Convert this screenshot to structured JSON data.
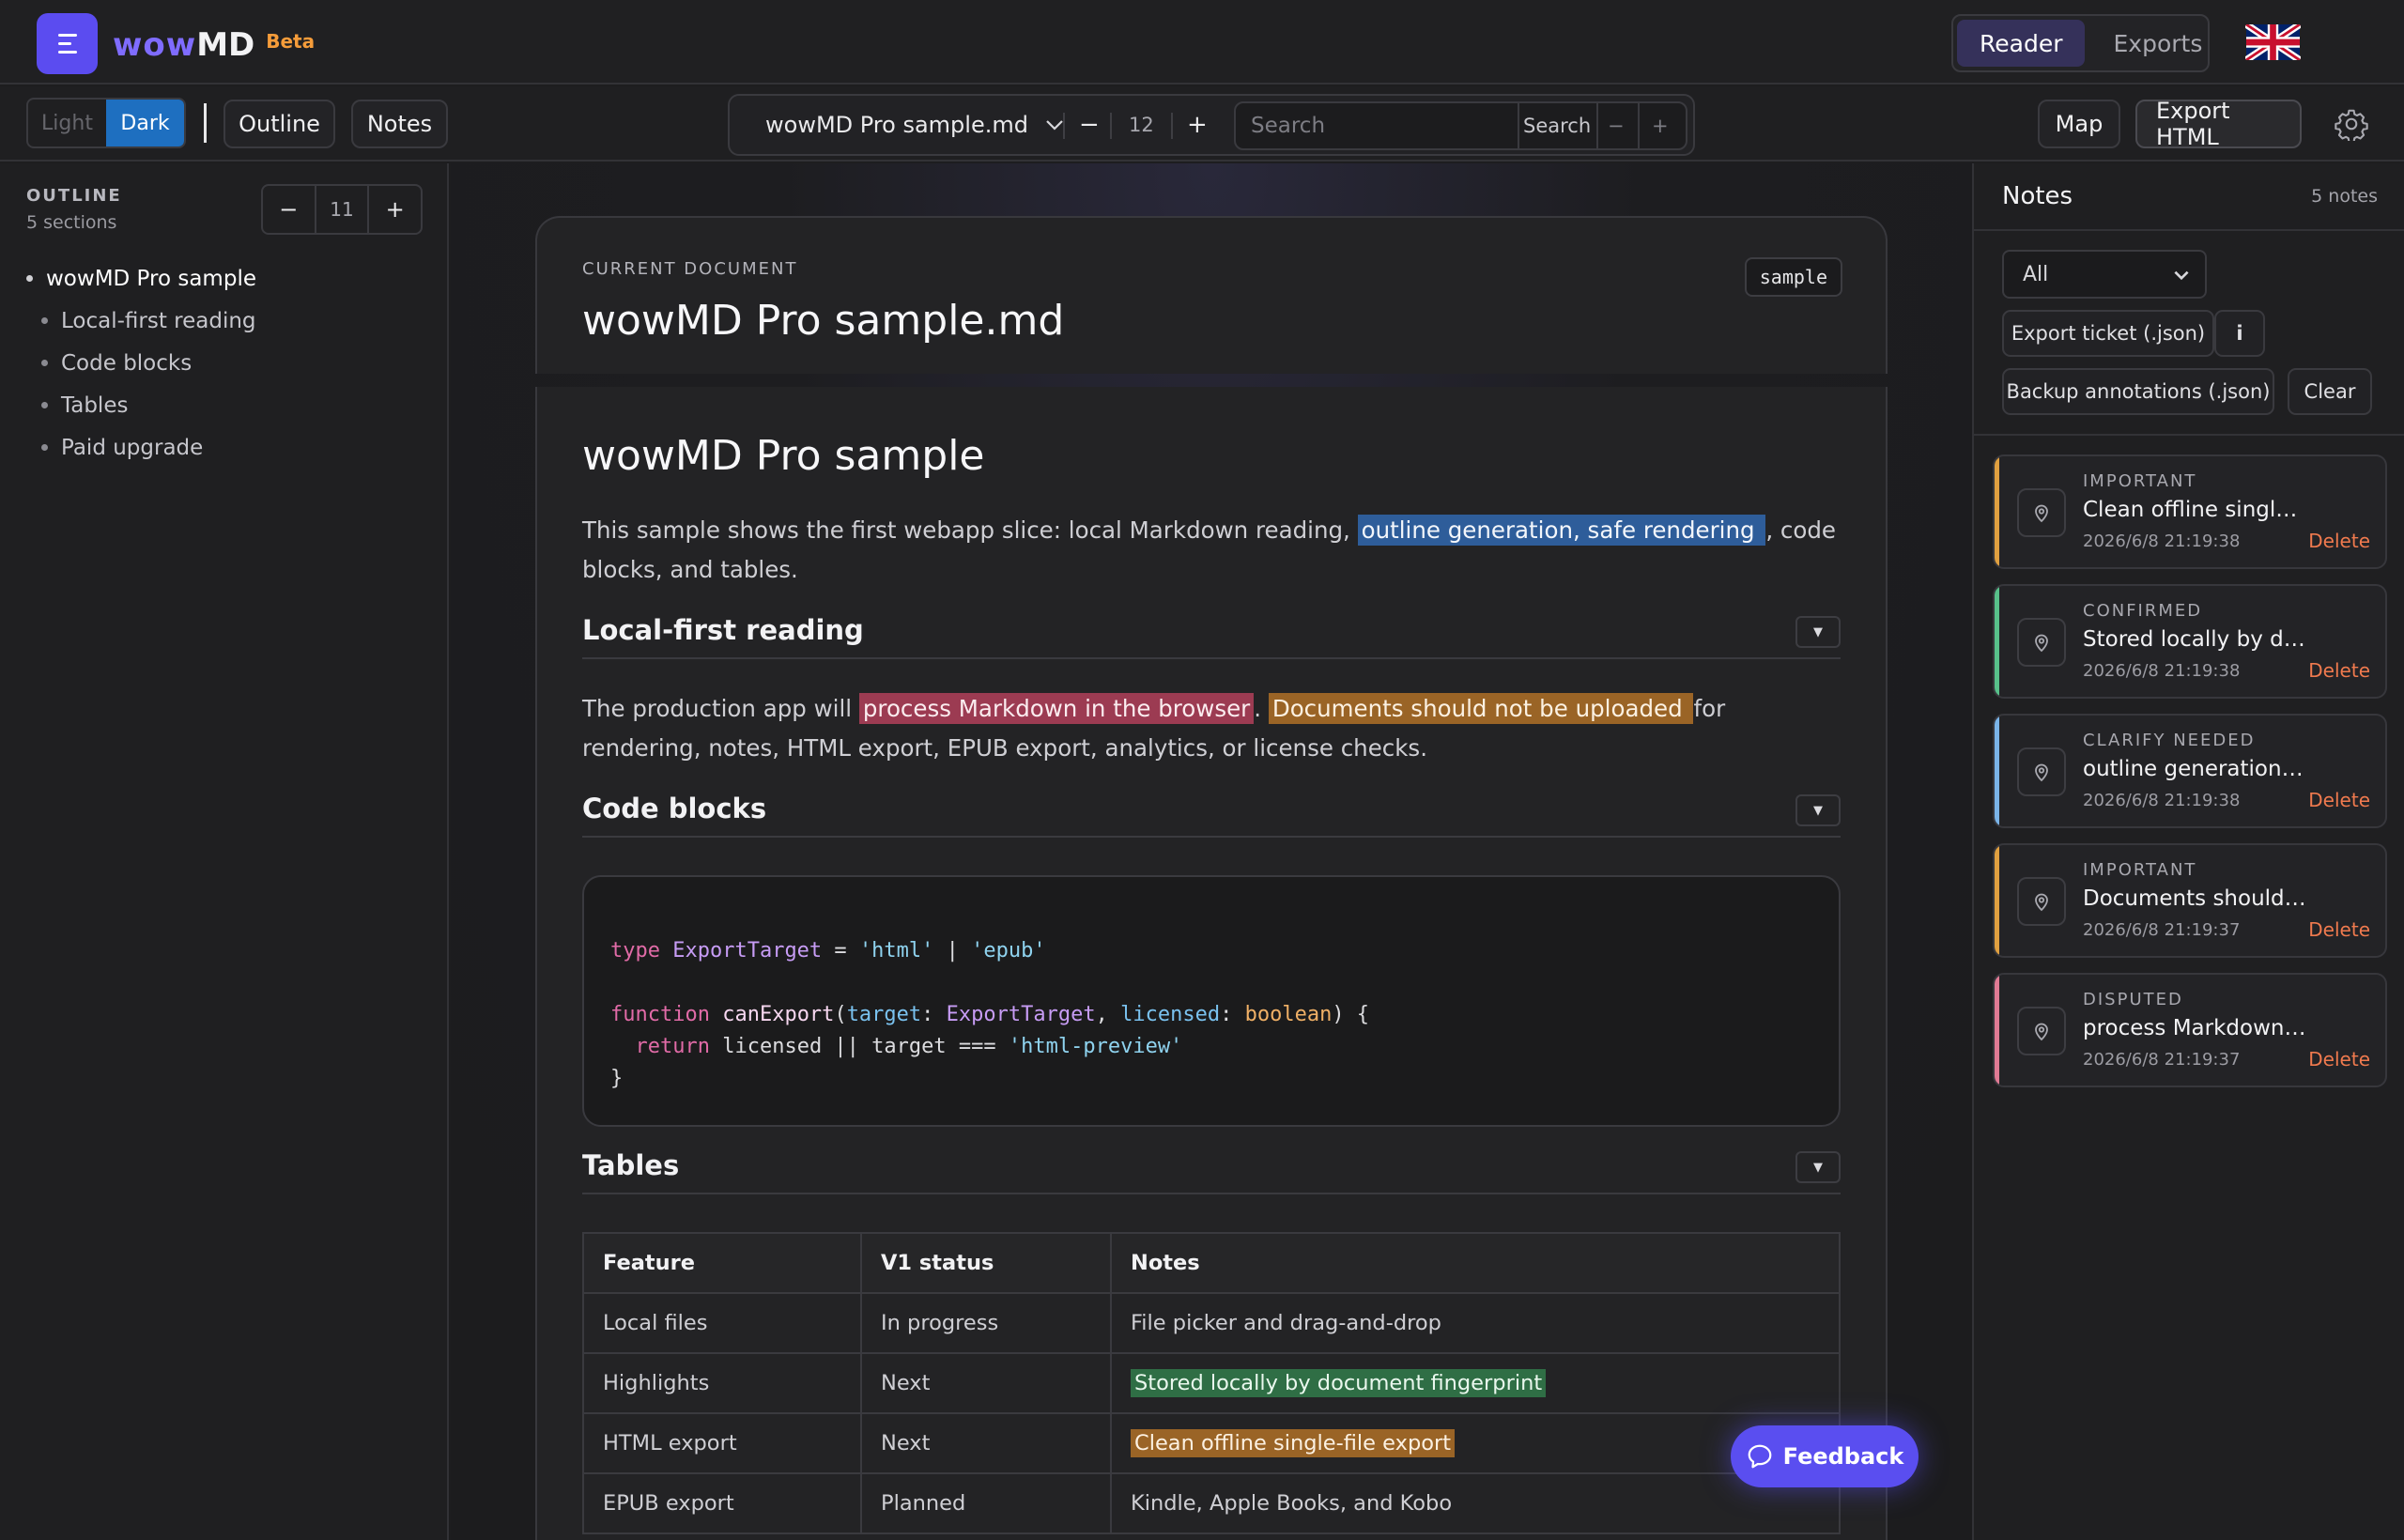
{
  "app": {
    "brand_wow": "wow",
    "brand_md": "MD",
    "beta": "Beta"
  },
  "top_tabs": [
    {
      "label": "Reader",
      "active": true
    },
    {
      "label": "Exports",
      "active": false
    }
  ],
  "toolbar": {
    "theme_light": "Light",
    "theme_dark": "Dark",
    "outline_btn": "Outline",
    "notes_btn": "Notes",
    "doc_name": "wowMD Pro sample.md",
    "font_minus": "−",
    "font_size": "12",
    "font_plus": "+",
    "search_placeholder": "Search",
    "search_btn": "Search",
    "search_prev": "−",
    "search_next": "+",
    "map_btn": "Map",
    "export_btn": "Export HTML"
  },
  "sidebar": {
    "label": "OUTLINE",
    "count": "5 sections",
    "stepper_minus": "−",
    "stepper_value": "11",
    "stepper_plus": "+",
    "items": [
      {
        "label": "wowMD Pro sample",
        "level": 1
      },
      {
        "label": "Local-first reading",
        "level": 2
      },
      {
        "label": "Code blocks",
        "level": 2
      },
      {
        "label": "Tables",
        "level": 2
      },
      {
        "label": "Paid upgrade",
        "level": 2
      }
    ]
  },
  "document": {
    "current_label": "CURRENT DOCUMENT",
    "title": "wowMD Pro sample.md",
    "tag": "sample",
    "h1": "wowMD Pro sample",
    "intro_1": "This sample shows the first webapp slice: local Markdown reading, ",
    "intro_hl": "outline generation, safe rendering ",
    "intro_2": ", code blocks, and tables.",
    "sec1_title": "Local-first reading",
    "sec1_p1": "The production app will ",
    "sec1_hl1": "process Markdown in the browser",
    "sec1_p2": ". ",
    "sec1_hl2": "Documents should not be uploaded ",
    "sec1_p3": " for rendering, notes, HTML export, EPUB export, analytics, or license checks.",
    "sec2_title": "Code blocks",
    "code": {
      "l1_kw": "type",
      "l1_ty": "ExportTarget",
      "l1_eq": " = ",
      "l1_s1": "'html'",
      "l1_bar": " | ",
      "l1_s2": "'epub'",
      "l2_kw": "function",
      "l2_fn": "canExport",
      "l2_p1": "target",
      "l2_ty": "ExportTarget",
      "l2_p2": "licensed",
      "l2_bo": "boolean",
      "l3_kw": "return",
      "l3_rest": " licensed || target === ",
      "l3_s": "'html-preview'",
      "l4": "}"
    },
    "sec3_title": "Tables",
    "table": {
      "headers": [
        "Feature",
        "V1 status",
        "Notes"
      ],
      "rows": [
        [
          "Local files",
          "In progress",
          "File picker and drag-and-drop"
        ],
        [
          "Highlights",
          "Next",
          "Stored locally by document fingerprint"
        ],
        [
          "HTML export",
          "Next",
          "Clean offline single-file export"
        ],
        [
          "EPUB export",
          "Planned",
          "Kindle, Apple Books, and Kobo"
        ]
      ]
    }
  },
  "feedback": "Feedback",
  "notes_panel": {
    "title": "Notes",
    "count": "5 notes",
    "filter": "All",
    "export_ticket": "Export ticket (.json)",
    "info": "i",
    "backup": "Backup annotations (.json)",
    "clear": "Clear",
    "delete_label": "Delete",
    "items": [
      {
        "kind": "IMPORTANT",
        "text": "Clean offline single-file export",
        "time": "2026/6/8 21:19:38",
        "color": "#e0a040"
      },
      {
        "kind": "CONFIRMED",
        "text": "Stored locally by document fingerprint",
        "time": "2026/6/8 21:19:38",
        "color": "#58c08a"
      },
      {
        "kind": "CLARIFY NEEDED",
        "text": "outline generation, safe rendering",
        "time": "2026/6/8 21:19:38",
        "color": "#7ab4e8"
      },
      {
        "kind": "IMPORTANT",
        "text": "Documents should not be uploaded",
        "time": "2026/6/8 21:19:37",
        "color": "#e0a040"
      },
      {
        "kind": "DISPUTED",
        "text": "process Markdown in the browser",
        "time": "2026/6/8 21:19:37",
        "color": "#e07a94"
      }
    ]
  }
}
